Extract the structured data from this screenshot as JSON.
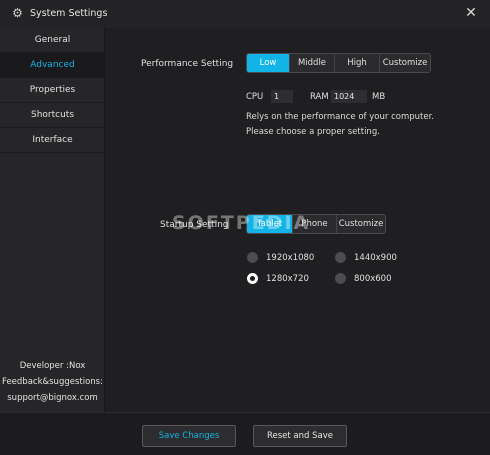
{
  "window": {
    "title": "System Settings",
    "title_icon": "gear-icon",
    "close_icon": "close-icon"
  },
  "sidebar": {
    "items": [
      {
        "label": "General",
        "active": false
      },
      {
        "label": "Advanced",
        "active": true
      },
      {
        "label": "Properties",
        "active": false
      },
      {
        "label": "Shortcuts",
        "active": false
      },
      {
        "label": "Interface",
        "active": false
      }
    ],
    "developer": "Developer :Nox",
    "feedback": "Feedback&suggestions:",
    "email": "support@bignox.com"
  },
  "performance": {
    "label": "Performance Setting",
    "options": [
      "Low",
      "Middle",
      "High",
      "Customize"
    ],
    "selected": "Low",
    "cpu_label": "CPU",
    "cpu_value": "1",
    "ram_label": "RAM",
    "ram_value": "1024",
    "ram_unit": "MB",
    "description_line1": "Relys on the performance of your computer.",
    "description_line2": "Please choose a proper setting."
  },
  "startup": {
    "label": "Startup Setting",
    "options": [
      "Tablet",
      "Phone",
      "Customize"
    ],
    "selected": "Tablet",
    "resolutions": [
      {
        "label": "1920x1080",
        "selected": false
      },
      {
        "label": "1440x900",
        "selected": false
      },
      {
        "label": "1280x720",
        "selected": true
      },
      {
        "label": "800x600",
        "selected": false
      }
    ]
  },
  "watermark": "SOFTPEDIA",
  "footer": {
    "save_changes": "Save Changes",
    "reset_and_save": "Reset and Save"
  },
  "colors": {
    "accent": "#12b3e6",
    "background": "#1f1f21",
    "sidebar": "#262628"
  }
}
